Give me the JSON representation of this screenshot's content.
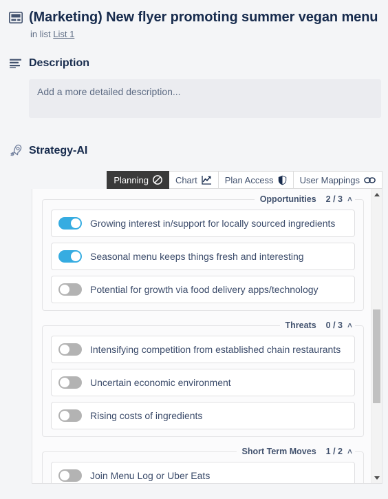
{
  "card": {
    "icon": "card-window-icon",
    "title": "(Marketing) New flyer promoting summer vegan menu",
    "in_list_prefix": "in list",
    "list_name": "List 1"
  },
  "description": {
    "icon": "description-lines-icon",
    "heading": "Description",
    "placeholder": "Add a more detailed description..."
  },
  "strategy": {
    "icon": "rocket-icon",
    "heading": "Strategy-AI",
    "tabs": [
      {
        "label": "Planning",
        "icon": "ban-circle-icon",
        "active": true
      },
      {
        "label": "Chart",
        "icon": "line-chart-icon",
        "active": false
      },
      {
        "label": "Plan Access",
        "icon": "shield-icon",
        "active": false
      },
      {
        "label": "User Mappings",
        "icon": "link-icon",
        "active": false
      }
    ],
    "groups": [
      {
        "title": "Opportunities",
        "count": "2 / 3",
        "caret": "˄",
        "items": [
          {
            "label": "Growing interest in/support for locally sourced ingredients",
            "on": true
          },
          {
            "label": "Seasonal menu keeps things fresh and interesting",
            "on": true
          },
          {
            "label": "Potential for growth via food delivery apps/technology",
            "on": false
          }
        ]
      },
      {
        "title": "Threats",
        "count": "0 / 3",
        "caret": "˄",
        "items": [
          {
            "label": "Intensifying competition from established chain restaurants",
            "on": false
          },
          {
            "label": "Uncertain economic environment",
            "on": false
          },
          {
            "label": "Rising costs of ingredients",
            "on": false
          }
        ]
      },
      {
        "title": "Short Term Moves",
        "count": "1 / 2",
        "caret": "˄",
        "items": [
          {
            "label": "Join Menu Log or Uber Eats",
            "on": false
          }
        ]
      }
    ]
  },
  "colors": {
    "page_background": "#f4f5f7",
    "toggle_on": "#36ace1",
    "toggle_off": "#b3b3b3",
    "active_tab_background": "#3a3a3a",
    "text_primary": "#172b4d",
    "text_muted": "#5e6c84"
  }
}
